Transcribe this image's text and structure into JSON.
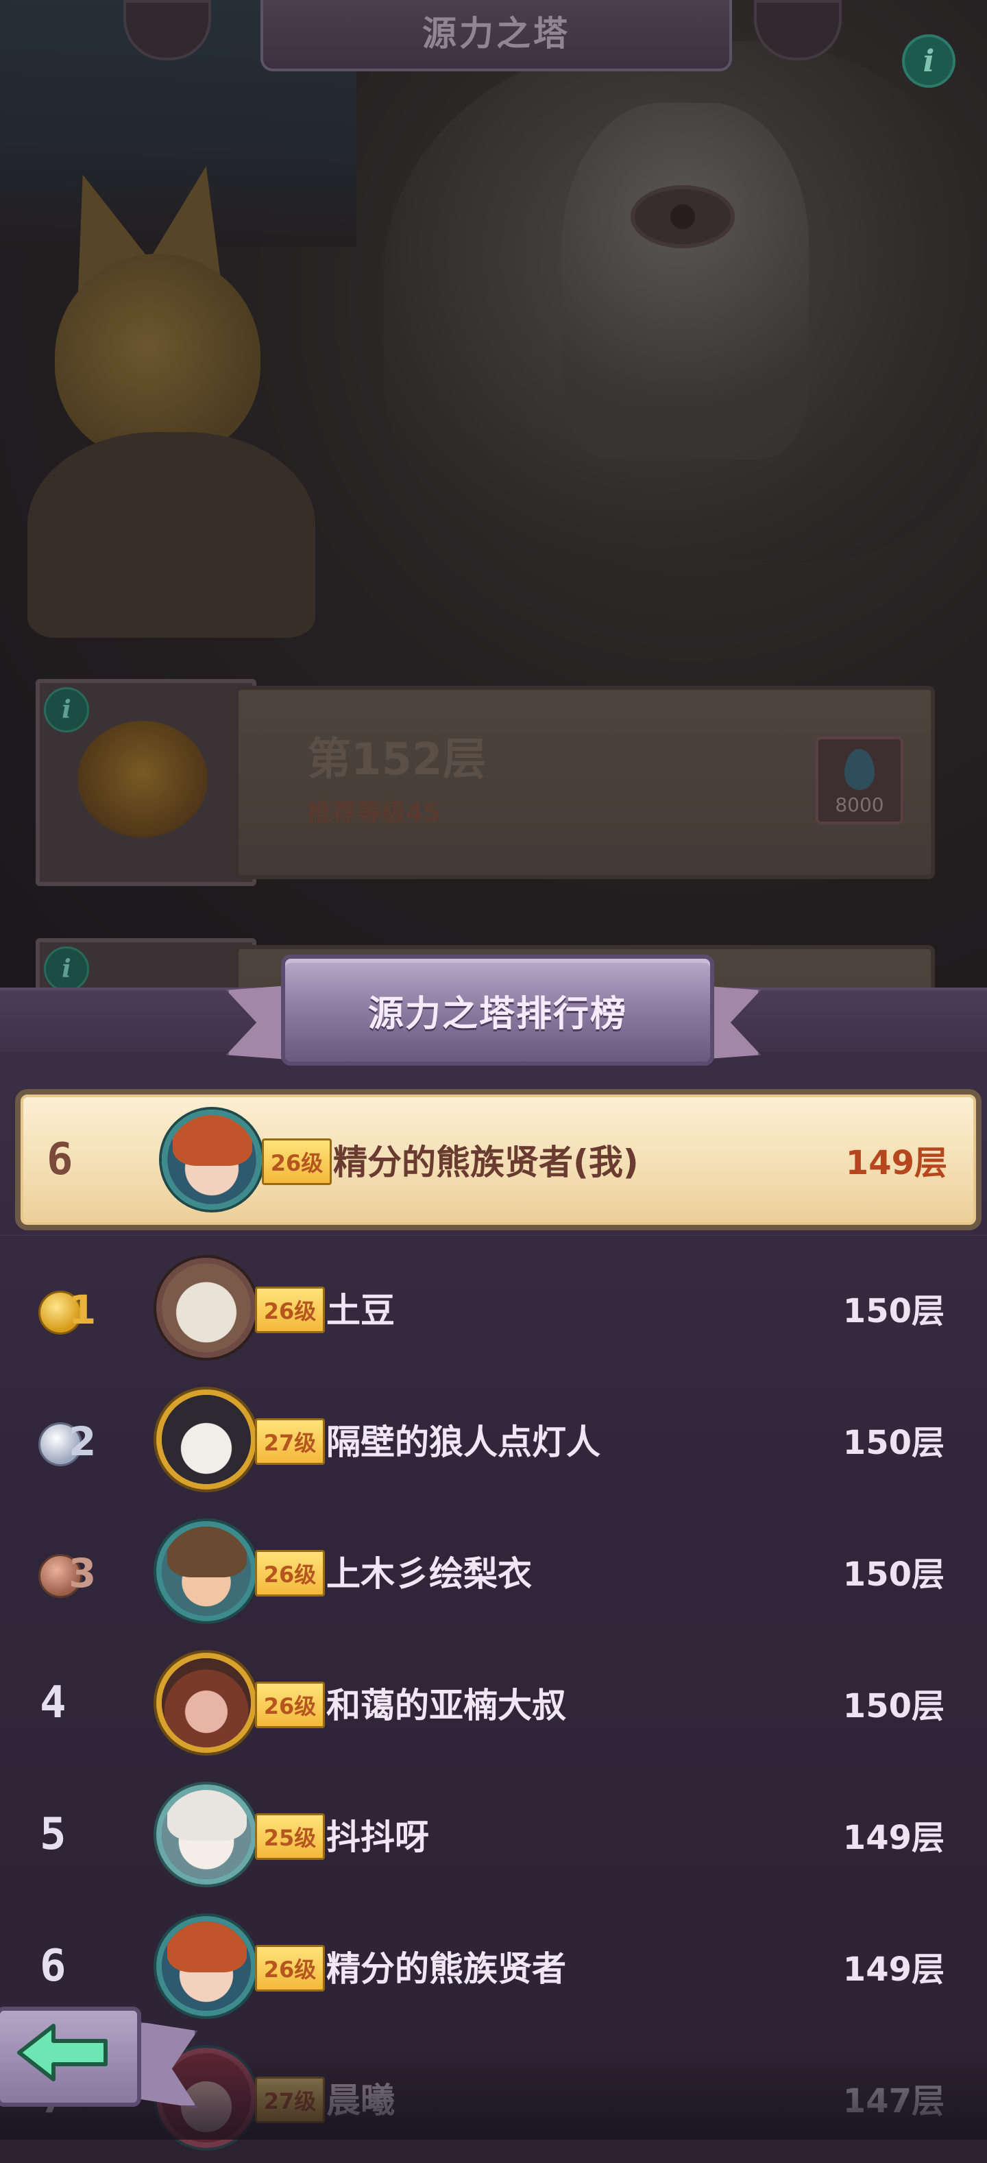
{
  "header": {
    "title": "源力之塔",
    "info_icon": "info-icon"
  },
  "levels": [
    {
      "floor": "第152层",
      "recommend": "推荐等级45",
      "reward_amount": "8000",
      "reward_icon": "water-drop-icon"
    }
  ],
  "leaderboard": {
    "title": "源力之塔排行榜",
    "my_row": {
      "rank": "6",
      "level": "26级",
      "name": "精分的熊族贤者(我)",
      "floor": "149层"
    },
    "rows": [
      {
        "rank": "1",
        "medal": "gold",
        "level": "26级",
        "name": "土豆",
        "floor": "150层"
      },
      {
        "rank": "2",
        "medal": "silver",
        "level": "27级",
        "name": "隔壁的狼人点灯人",
        "floor": "150层"
      },
      {
        "rank": "3",
        "medal": "bronze",
        "level": "26级",
        "name": "上木彡绘梨衣",
        "floor": "150层"
      },
      {
        "rank": "4",
        "level": "26级",
        "name": "和蔼的亚楠大叔",
        "floor": "150层"
      },
      {
        "rank": "5",
        "level": "25级",
        "name": "抖抖呀",
        "floor": "149层"
      },
      {
        "rank": "6",
        "level": "26级",
        "name": "精分的熊族贤者",
        "floor": "149层"
      },
      {
        "rank": "7",
        "level": "27级",
        "name": "晨曦",
        "floor": "147层"
      }
    ]
  },
  "back_button": {
    "icon": "back-arrow-icon"
  },
  "colors": {
    "panel": "#31273a",
    "highlight": "#f4dfb4",
    "level_badge": "#f3b93a",
    "my_floor": "#b5461d"
  }
}
